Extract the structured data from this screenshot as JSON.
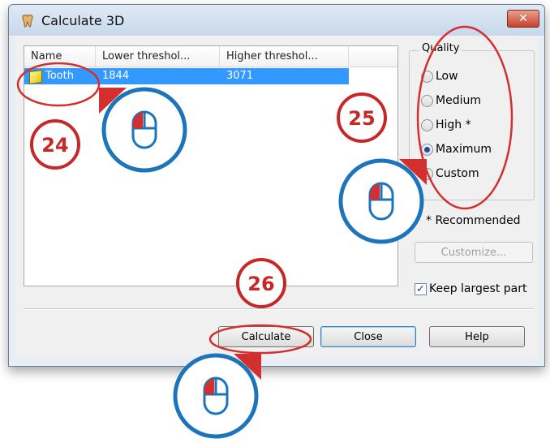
{
  "window": {
    "title": "Calculate 3D",
    "close_glyph": "✕"
  },
  "list": {
    "columns": [
      "Name",
      "Lower threshol...",
      "Higher threshol..."
    ],
    "rows": [
      {
        "name": "Tooth",
        "lower": "1844",
        "higher": "3071"
      }
    ]
  },
  "quality": {
    "title": "Quality",
    "options": [
      "Low",
      "Medium",
      "High *",
      "Maximum",
      "Custom"
    ],
    "selected": "Maximum"
  },
  "recommended_text": "* Recommended",
  "buttons": {
    "customize": "Customize...",
    "calculate": "Calculate",
    "close": "Close",
    "help": "Help"
  },
  "keep_largest": {
    "label": "Keep largest part",
    "checked": true
  },
  "annotations": {
    "step_24": "24",
    "step_25": "25",
    "step_26": "26"
  },
  "colors": {
    "annotation_red": "#c62828",
    "mouse_blue": "#1c75bc",
    "selection": "#3399ff"
  }
}
